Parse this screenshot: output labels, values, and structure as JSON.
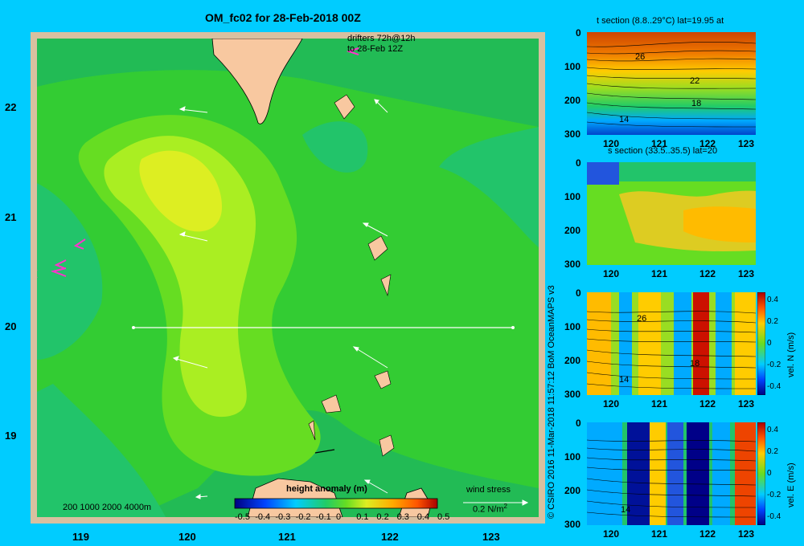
{
  "title": "OM_fc02 for 28-Feb-2018 00Z",
  "drifters_label_1": "drifters 72h@12h",
  "drifters_label_2": "to 28-Feb 12Z",
  "depth_legend": "200  1000  2000  4000m",
  "colorbar_title": "height anomaly (m)",
  "colorbar_ticks": [
    "-0.5",
    "-0.4",
    "-0.3",
    "-0.2",
    "-0.1",
    "0",
    "0.1",
    "0.2",
    "0.3",
    "0.4",
    "0.5"
  ],
  "wind_stress_label": "wind stress",
  "wind_stress_value": "0.2 N/m",
  "wind_stress_sup": "2",
  "credit": "© CSIRO 2016   11-Mar-2018 11:57:12 BoM OceanMAPS v3",
  "colors": {
    "background": "#00ccff",
    "land": "#f8c8a0",
    "coast_border": "#d8c0a0"
  },
  "chart_data": [
    {
      "type": "heatmap",
      "title": "OM_fc02 for 28-Feb-2018 00Z",
      "x_ticks": [
        "119",
        "120",
        "121",
        "122",
        "123"
      ],
      "y_ticks": [
        "19",
        "20",
        "21",
        "22"
      ],
      "xlim": [
        118.5,
        123.5
      ],
      "ylim": [
        18.3,
        22.65
      ],
      "colorbar": {
        "label": "height anomaly (m)",
        "range": [
          -0.5,
          0.5
        ]
      },
      "section_line_lat": 20,
      "section_line_lon": [
        119.5,
        123.2
      ]
    },
    {
      "type": "heatmap",
      "title": "t section (8.8..29°C) lat=19.95 at",
      "x_ticks": [
        "120",
        "121",
        "122",
        "123"
      ],
      "y_ticks": [
        "0",
        "100",
        "200",
        "300"
      ],
      "contour_labels": [
        "26",
        "22",
        "18",
        "14"
      ]
    },
    {
      "type": "heatmap",
      "title": "s section (33.5..35.5) lat=20",
      "x_ticks": [
        "120",
        "121",
        "122",
        "123"
      ],
      "y_ticks": [
        "0",
        "100",
        "200",
        "300"
      ]
    },
    {
      "type": "heatmap",
      "title": "",
      "x_ticks": [
        "120",
        "121",
        "122",
        "123"
      ],
      "y_ticks": [
        "0",
        "100",
        "200",
        "300"
      ],
      "contour_labels": [
        "26",
        "18",
        "14"
      ],
      "colorbar": {
        "label": "vel. N  (m/s)",
        "ticks": [
          "0.4",
          "0.2",
          "0",
          "-0.2",
          "-0.4"
        ]
      }
    },
    {
      "type": "heatmap",
      "title": "",
      "x_ticks": [
        "120",
        "121",
        "122",
        "123"
      ],
      "y_ticks": [
        "0",
        "100",
        "200",
        "300"
      ],
      "contour_labels": [
        "14"
      ],
      "colorbar": {
        "label": "vel. E  (m/s)",
        "ticks": [
          "0.4",
          "0.2",
          "0",
          "-0.2",
          "-0.4"
        ]
      }
    }
  ]
}
